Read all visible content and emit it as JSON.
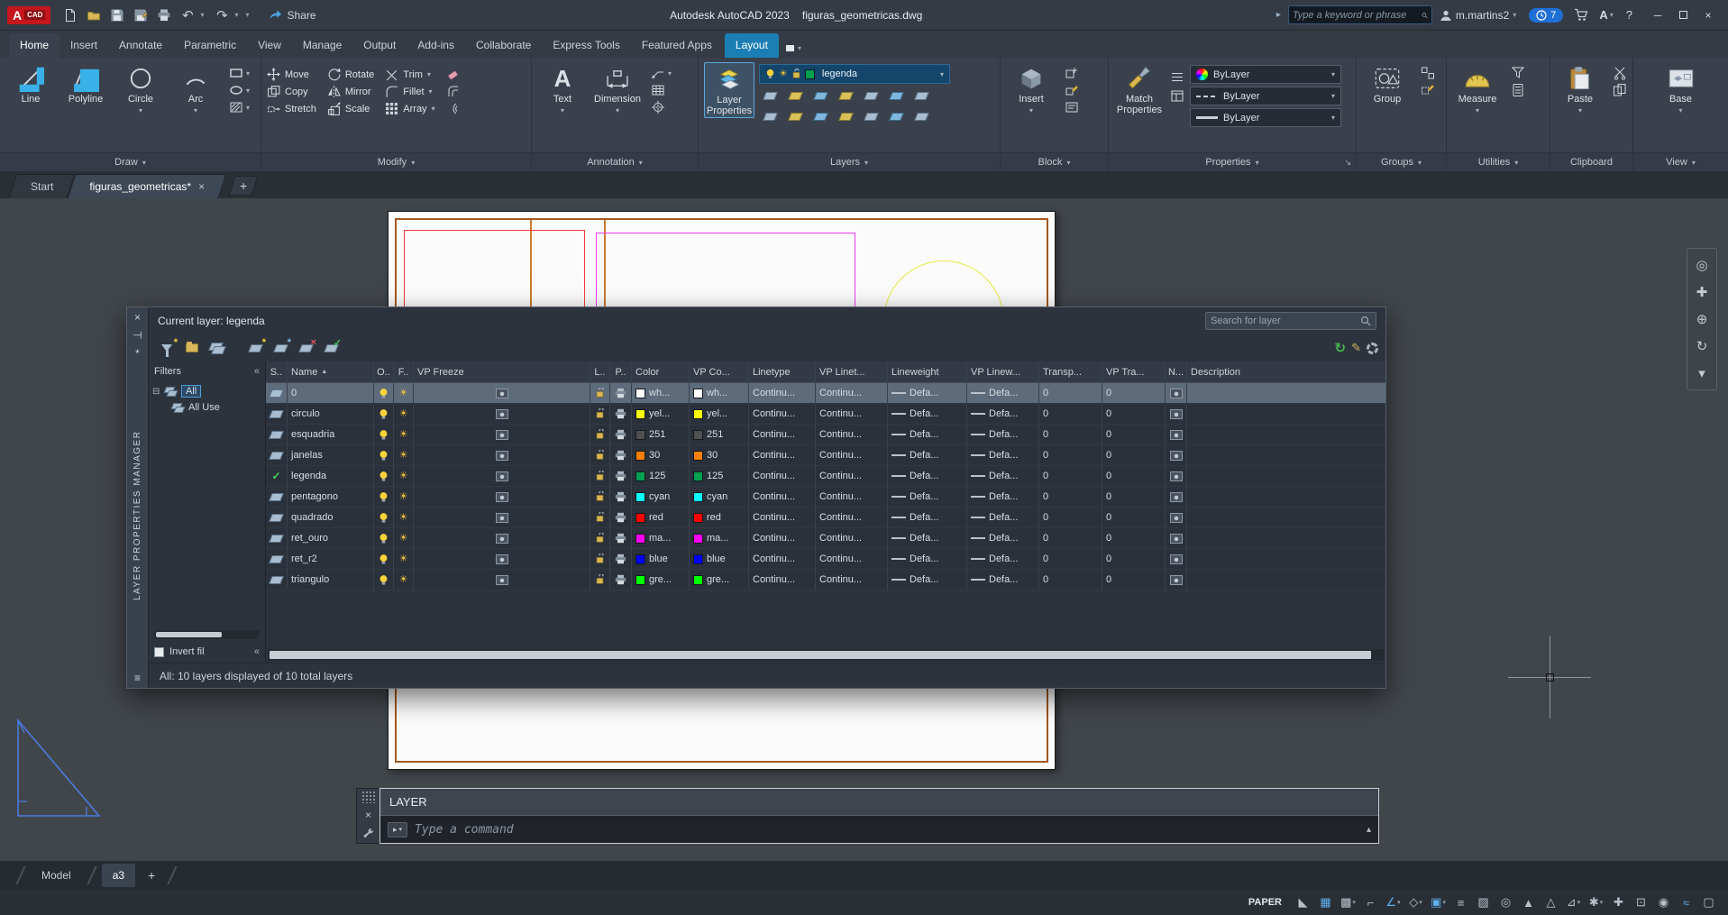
{
  "icons": {
    "sun": "☀",
    "caret_down": "▾",
    "caret_up": "▴",
    "sort_asc": "▲",
    "close": "×",
    "minimize": "─",
    "check": "✓",
    "collapse": "«",
    "expand_right": "▸",
    "plus": "+",
    "refresh": "↻",
    "star": "*",
    "question": "?",
    "undo": "↶",
    "redo": "↷",
    "expand_box": "⊟",
    "autohide": "⊣",
    "pencil": "✎",
    "menu": "≡",
    "prompt": "▸"
  },
  "titlebar": {
    "logo": "A",
    "logo_sub": "CAD",
    "share": "Share",
    "app_title": "Autodesk AutoCAD 2023",
    "doc_title": "figuras_geometricas.dwg",
    "search_placeholder": "Type a keyword or phrase",
    "username": "m.martins2",
    "badge_count": "7"
  },
  "ribbon": {
    "tabs": [
      {
        "label": "Home",
        "state": "active"
      },
      {
        "label": "Insert"
      },
      {
        "label": "Annotate"
      },
      {
        "label": "Parametric"
      },
      {
        "label": "View"
      },
      {
        "label": "Manage"
      },
      {
        "label": "Output"
      },
      {
        "label": "Add-ins"
      },
      {
        "label": "Collaborate"
      },
      {
        "label": "Express Tools"
      },
      {
        "label": "Featured Apps"
      },
      {
        "label": "Layout",
        "state": "contextual"
      }
    ],
    "panels": {
      "draw": {
        "label": "Draw",
        "line": "Line",
        "polyline": "Polyline",
        "circle": "Circle",
        "arc": "Arc"
      },
      "modify": {
        "label": "Modify",
        "move": "Move",
        "rotate": "Rotate",
        "trim": "Trim",
        "copy": "Copy",
        "mirror": "Mirror",
        "fillet": "Fillet",
        "stretch": "Stretch",
        "scale": "Scale",
        "array": "Array"
      },
      "annotation": {
        "label": "Annotation",
        "text": "Text",
        "dimension": "Dimension"
      },
      "layers": {
        "label": "Layers",
        "big_line1": "Layer",
        "big_line2": "Properties",
        "current_layer": "legenda"
      },
      "block": {
        "label": "Block",
        "insert": "Insert"
      },
      "properties": {
        "label": "Properties",
        "big_line1": "Match",
        "big_line2": "Properties",
        "color_value": "ByLayer",
        "linetype_value": "ByLayer",
        "lineweight_value": "ByLayer"
      },
      "groups": {
        "label": "Groups",
        "group": "Group"
      },
      "utilities": {
        "label": "Utilities",
        "measure": "Measure"
      },
      "clipboard": {
        "label": "Clipboard",
        "paste": "Paste"
      },
      "view": {
        "label": "View",
        "base": "Base"
      }
    }
  },
  "file_tabs": {
    "tabs": [
      {
        "label": "Start"
      },
      {
        "label": "figuras_geometricas*",
        "active": true
      }
    ]
  },
  "layer_manager": {
    "title": "LAYER PROPERTIES MANAGER",
    "current_layer": "Current layer: legenda",
    "search_placeholder": "Search for layer",
    "filters_label": "Filters",
    "filter_all": "All",
    "filter_all_used": "All Use",
    "invert_filter": "Invert fil",
    "status": "All: 10 layers displayed of 10 total layers",
    "columns": [
      "S..",
      "Name",
      "O..",
      "F..",
      "VP Freeze",
      "L..",
      "P..",
      "Color",
      "VP Co...",
      "Linetype",
      "VP Linet...",
      "Lineweight",
      "VP Linew...",
      "Transp...",
      "VP Tra...",
      "N...",
      "Description"
    ],
    "rows": [
      {
        "name": "0",
        "selected": true,
        "color_label": "wh...",
        "color": "#ffffff",
        "vp_color_label": "wh...",
        "linetype": "Continu...",
        "vp_linetype": "Continu...",
        "lineweight": "Defa...",
        "vp_lineweight": "Defa...",
        "transparency": "0",
        "vp_transparency": "0"
      },
      {
        "name": "circulo",
        "color_label": "yel...",
        "color": "#ffff00",
        "vp_color_label": "yel...",
        "linetype": "Continu...",
        "vp_linetype": "Continu...",
        "lineweight": "Defa...",
        "vp_lineweight": "Defa...",
        "transparency": "0",
        "vp_transparency": "0"
      },
      {
        "name": "esquadria",
        "color_label": "251",
        "color": "#505050",
        "vp_color_label": "251",
        "linetype": "Continu...",
        "vp_linetype": "Continu...",
        "lineweight": "Defa...",
        "vp_lineweight": "Defa...",
        "transparency": "0",
        "vp_transparency": "0"
      },
      {
        "name": "janelas",
        "color_label": "30",
        "color": "#ff7f00",
        "vp_color_label": "30",
        "linetype": "Continu...",
        "vp_linetype": "Continu...",
        "lineweight": "Defa...",
        "vp_lineweight": "Defa...",
        "transparency": "0",
        "vp_transparency": "0"
      },
      {
        "name": "legenda",
        "current": true,
        "color_label": "125",
        "color": "#00a050",
        "vp_color_label": "125",
        "linetype": "Continu...",
        "vp_linetype": "Continu...",
        "lineweight": "Defa...",
        "vp_lineweight": "Defa...",
        "transparency": "0",
        "vp_transparency": "0"
      },
      {
        "name": "pentagono",
        "color_label": "cyan",
        "color": "#00ffff",
        "vp_color_label": "cyan",
        "linetype": "Continu...",
        "vp_linetype": "Continu...",
        "lineweight": "Defa...",
        "vp_lineweight": "Defa...",
        "transparency": "0",
        "vp_transparency": "0"
      },
      {
        "name": "quadrado",
        "color_label": "red",
        "color": "#ff0000",
        "vp_color_label": "red",
        "linetype": "Continu...",
        "vp_linetype": "Continu...",
        "lineweight": "Defa...",
        "vp_lineweight": "Defa...",
        "transparency": "0",
        "vp_transparency": "0"
      },
      {
        "name": "ret_ouro",
        "color_label": "ma...",
        "color": "#ff00ff",
        "vp_color_label": "ma...",
        "linetype": "Continu...",
        "vp_linetype": "Continu...",
        "lineweight": "Defa...",
        "vp_lineweight": "Defa...",
        "transparency": "0",
        "vp_transparency": "0"
      },
      {
        "name": "ret_r2",
        "color_label": "blue",
        "color": "#0000ff",
        "vp_color_label": "blue",
        "linetype": "Continu...",
        "vp_linetype": "Continu...",
        "lineweight": "Defa...",
        "vp_lineweight": "Defa...",
        "transparency": "0",
        "vp_transparency": "0"
      },
      {
        "name": "triangulo",
        "color_label": "gre...",
        "color": "#00ff00",
        "vp_color_label": "gre...",
        "linetype": "Continu...",
        "vp_linetype": "Continu...",
        "lineweight": "Defa...",
        "vp_lineweight": "Defa...",
        "transparency": "0",
        "vp_transparency": "0"
      }
    ]
  },
  "command": {
    "history_line": "LAYER",
    "prompt": "Type a command"
  },
  "layout_tabs": {
    "tabs": [
      {
        "label": "Model"
      },
      {
        "label": "a3",
        "active": true
      }
    ]
  },
  "status_bar": {
    "paper_label": "PAPER",
    "icons": [
      {
        "name": "model-paper-icon",
        "glyph": "◣"
      },
      {
        "name": "grid-icon",
        "glyph": "▦",
        "accent": true
      },
      {
        "name": "snap-icon",
        "glyph": "▩",
        "caret": true
      },
      {
        "name": "ortho-icon",
        "glyph": "⌐"
      },
      {
        "name": "polar-icon",
        "glyph": "∠",
        "accent": true,
        "caret": true
      },
      {
        "name": "isodraft-icon",
        "glyph": "◇",
        "caret": true
      },
      {
        "name": "osnap-icon",
        "glyph": "▣",
        "accent": true,
        "caret": true
      },
      {
        "name": "lineweight-icon",
        "glyph": "≡"
      },
      {
        "name": "transparency-icon",
        "glyph": "▨"
      },
      {
        "name": "selection-cycling-icon",
        "glyph": "◎"
      },
      {
        "name": "annotation-visibility-icon",
        "glyph": "▲"
      },
      {
        "name": "autoscale-icon",
        "glyph": "△"
      },
      {
        "name": "annotation-scale-icon",
        "glyph": "⊿",
        "caret": true
      },
      {
        "name": "workspace-icon",
        "glyph": "✱",
        "caret": true
      },
      {
        "name": "annotation-monitor-icon",
        "glyph": "✚"
      },
      {
        "name": "units-icon",
        "glyph": "⊡"
      },
      {
        "name": "isolate-icon",
        "glyph": "◉"
      },
      {
        "name": "graphics-performance-icon",
        "glyph": "≈",
        "accent": true
      },
      {
        "name": "clean-screen-icon",
        "glyph": "▢"
      }
    ]
  },
  "nav_bar": {
    "icons": [
      {
        "name": "navigation-wheel-icon",
        "glyph": "◎"
      },
      {
        "name": "pan-icon",
        "glyph": "✚"
      },
      {
        "name": "zoom-icon",
        "glyph": "⊕"
      },
      {
        "name": "orbit-icon",
        "glyph": "↻"
      },
      {
        "name": "nav-more-icon",
        "glyph": "▾"
      }
    ]
  }
}
